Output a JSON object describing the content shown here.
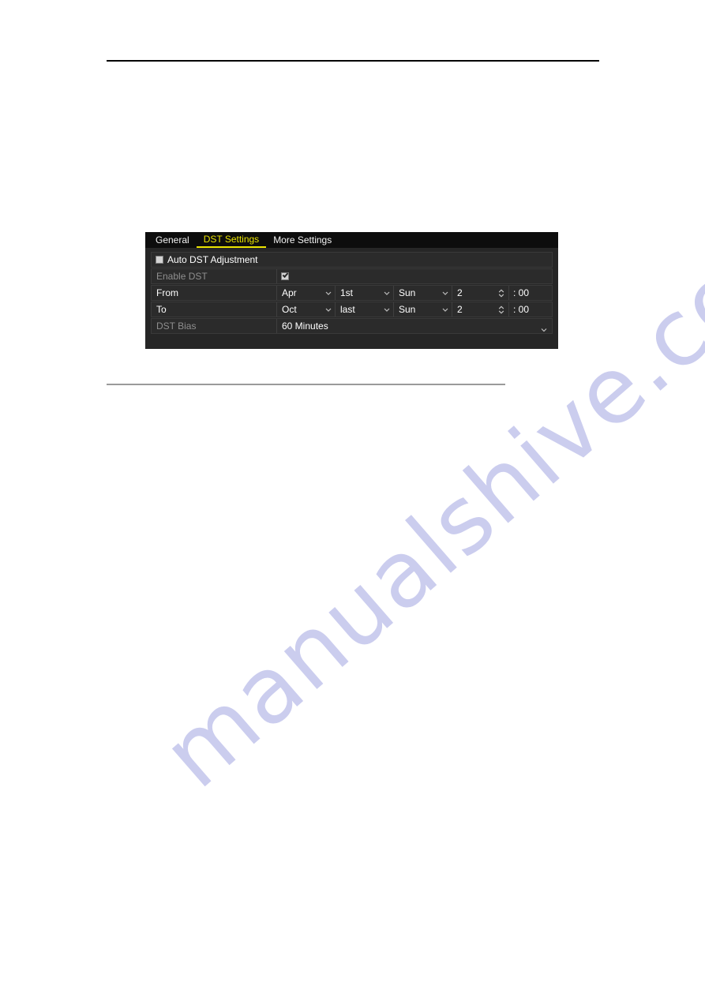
{
  "page": {
    "background_color": "#ffffff",
    "rules": {
      "top_color": "#000000",
      "bottom_color": "#9a9a9a"
    },
    "watermark": {
      "text": "manualshive.com",
      "color": "#c9cbee"
    }
  },
  "dialog": {
    "background_color": "#262626",
    "tabbar": {
      "background_color": "#0d0d0d",
      "active_color": "#ebe400",
      "tabs": [
        {
          "label": "General",
          "active": false
        },
        {
          "label": "DST Settings",
          "active": true
        },
        {
          "label": "More Settings",
          "active": false
        }
      ]
    },
    "auto_dst": {
      "label": "Auto DST Adjustment",
      "checked": false
    },
    "rows": {
      "enable_dst": {
        "label": "Enable DST",
        "checked": true
      },
      "from": {
        "label": "From",
        "month": "Apr",
        "ordinal": "1st",
        "weekday": "Sun",
        "hour": "2",
        "minute": ": 00"
      },
      "to": {
        "label": "To",
        "month": "Oct",
        "ordinal": "last",
        "weekday": "Sun",
        "hour": "2",
        "minute": ": 00"
      },
      "dst_bias": {
        "label": "DST Bias",
        "value": "60 Minutes"
      }
    },
    "icons": {
      "dropdown": "chevron-down-icon",
      "spinner": "up-down-spinner-icon",
      "checkbox": "checkbox-icon"
    }
  }
}
